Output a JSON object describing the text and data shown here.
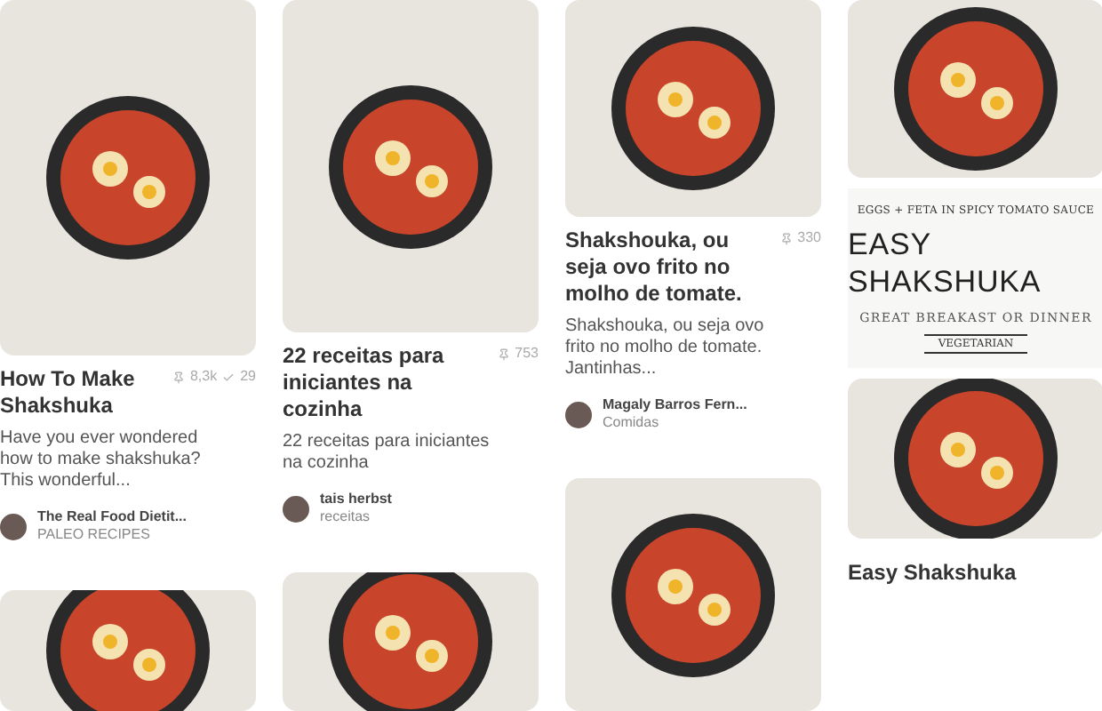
{
  "columns": [
    {
      "pins": [
        {
          "kind": "pin",
          "title": "How To Make Shakshuka",
          "saves": "8,3k",
          "likes": "29",
          "description": "Have you ever wondered how to make shakshuka? This wonderful...",
          "author": "The Real Food Dietit...",
          "board": "PALEO RECIPES"
        },
        {
          "kind": "photo"
        }
      ]
    },
    {
      "pins": [
        {
          "kind": "pin",
          "title": "22 receitas para iniciantes na cozinha",
          "saves": "753",
          "description": "22 receitas para iniciantes na cozinha",
          "author": "tais herbst",
          "board": "receitas"
        },
        {
          "kind": "photo"
        }
      ]
    },
    {
      "pins": [
        {
          "kind": "pin",
          "title": "Shakshouka, ou seja ovo frito no molho de tomate.",
          "saves": "330",
          "description": "Shakshouka, ou seja ovo frito no molho de tomate. Jantinhas...",
          "author": "Magaly Barros Fern...",
          "board": "Comidas"
        },
        {
          "kind": "photo"
        }
      ]
    },
    {
      "pins": [
        {
          "kind": "photo"
        },
        {
          "kind": "graphic",
          "arc_text": "EGGS + FETA IN SPICY TOMATO SAUCE",
          "heading": "EASY SHAKSHUKA",
          "subheading": "GREAT BREAKAST OR DINNER",
          "tag": "VEGETARIAN"
        },
        {
          "kind": "photo"
        },
        {
          "kind": "pin",
          "title": "Easy Shakshuka"
        }
      ]
    }
  ]
}
